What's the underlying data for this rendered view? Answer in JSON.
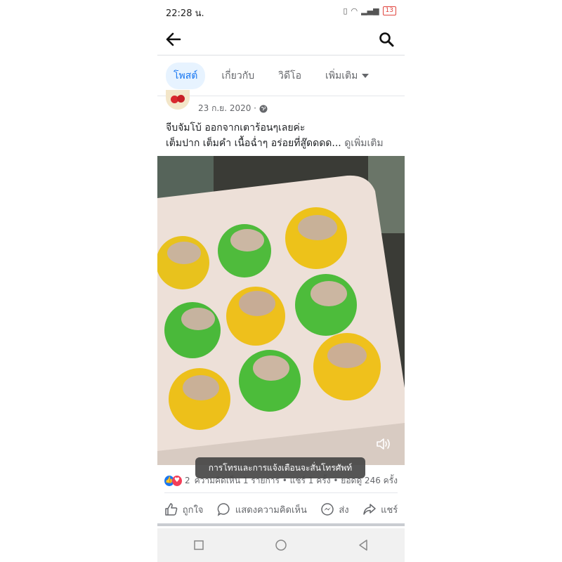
{
  "status_bar": {
    "time": "22:28 น.",
    "battery": "13"
  },
  "tabs": [
    {
      "label": "โพสต์",
      "active": true
    },
    {
      "label": "เกี่ยวกับ",
      "active": false
    },
    {
      "label": "วิดีโอ",
      "active": false
    },
    {
      "label": "เพิ่มเติม",
      "active": false
    }
  ],
  "post": {
    "date": "23 ก.ย. 2020 ·",
    "line1": "จีบจัมโบ้ ออกจากเตาร้อนๆเลยค่ะ",
    "line2": "เต็มปาก เต็มคำ เนื้อฉ่ำๆ อร่อยที่สู๊ดดดด...",
    "see_more": "ดูเพิ่มเติม"
  },
  "toast": "การโทรและการแจ้งเตือนจะสั่นโทรศัพท์",
  "stats": {
    "reaction_count": "2",
    "summary": "ความคิดเห็น 1 รายการ • แชร์ 1 ครั้ง • ยอดดู 246 ครั้ง"
  },
  "actions": {
    "like": "ถูกใจ",
    "comment": "แสดงความคิดเห็น",
    "send": "ส่ง",
    "share": "แชร์"
  },
  "colors": {
    "accent": "#1877f2",
    "love": "#f33e58"
  },
  "icons": [
    "back-arrow-icon",
    "search-icon",
    "globe-icon",
    "volume-icon",
    "like-icon",
    "comment-icon",
    "messenger-icon",
    "share-icon"
  ]
}
